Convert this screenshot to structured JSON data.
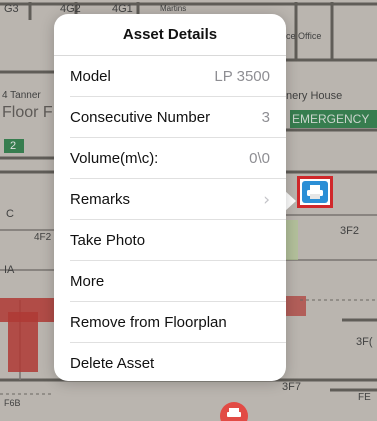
{
  "floorplan": {
    "labels": {
      "g3": "G3",
      "4g2": "4G2",
      "4g1": "4G1",
      "martins": "Martins",
      "ice_office": "ice  Office",
      "tannery_left": "4 Tanner",
      "floor_f": "Floor F",
      "green_2": "2",
      "emergency": "EMERGENCY",
      "nery_house": "nery House",
      "c": "C",
      "4f2": "4F2",
      "ia": "IA",
      "3f2": "3F2",
      "3f_right": "3F(",
      "3f7": "3F7",
      "f6b": "F6B",
      "fe": "FE"
    }
  },
  "popover": {
    "title": "Asset Details",
    "rows": [
      {
        "label": "Model",
        "value": "LP 3500"
      },
      {
        "label": "Consecutive Number",
        "value": "3"
      },
      {
        "label": "Volume(m\\c):",
        "value": "0\\0"
      },
      {
        "label": "Remarks",
        "value": "›"
      },
      {
        "label": "Take Photo"
      },
      {
        "label": "More"
      },
      {
        "label": "Remove from Floorplan"
      },
      {
        "label": "Delete Asset"
      }
    ]
  },
  "colors": {
    "marker_border": "#d0282b",
    "marker_fill": "#2b8fd6",
    "emergency_green": "#3f8f5a",
    "wall_red": "#c8423c"
  },
  "icons": {
    "asset_marker": "printer-icon",
    "bottom_marker": "printer-icon"
  }
}
